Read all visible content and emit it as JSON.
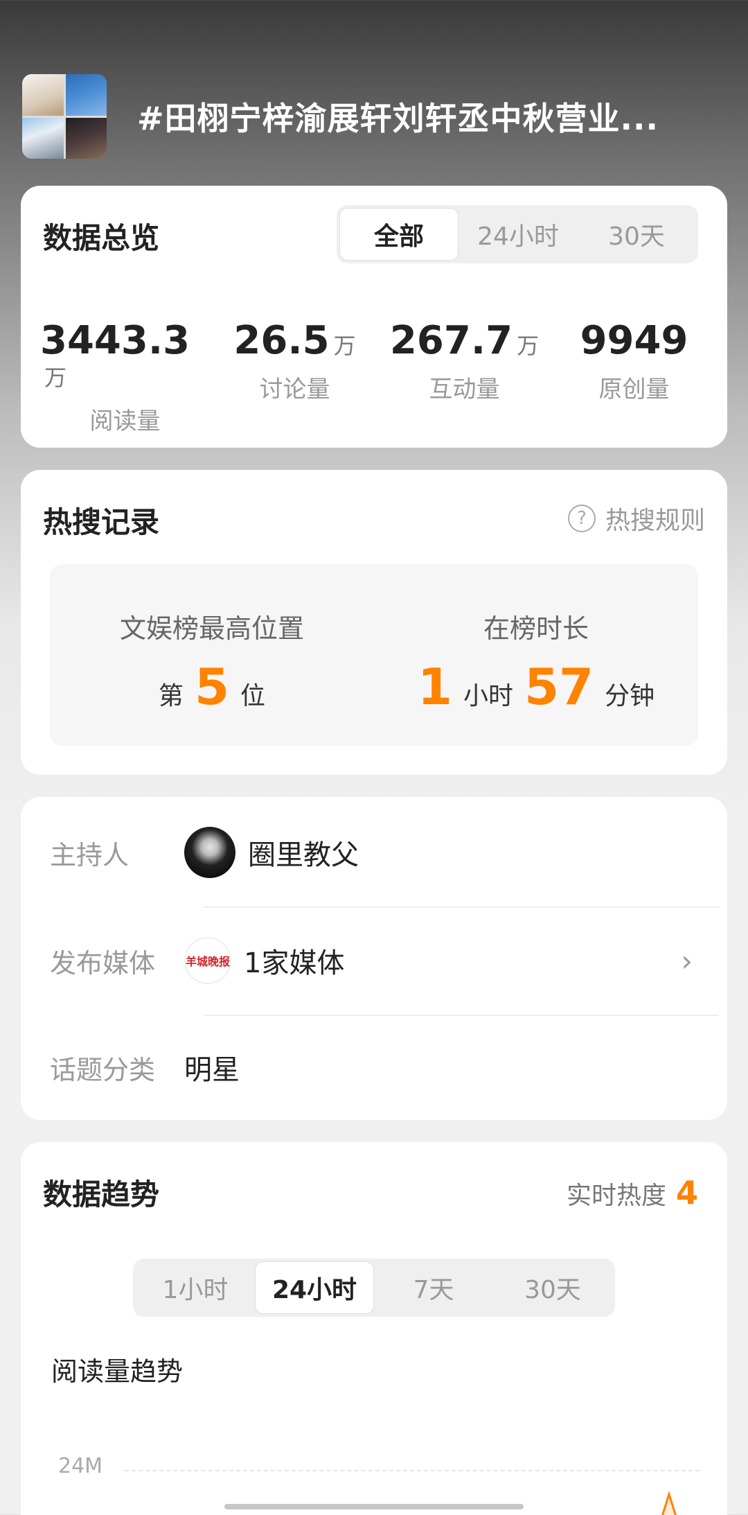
{
  "header": {
    "title": "#田栩宁梓渝展轩刘轩丞中秋营业..."
  },
  "overview": {
    "title": "数据总览",
    "tabs": [
      {
        "label": "全部",
        "active": true
      },
      {
        "label": "24小时",
        "active": false
      },
      {
        "label": "30天",
        "active": false
      }
    ],
    "stats": [
      {
        "value": "3443.3",
        "unit": "万",
        "label": "阅读量"
      },
      {
        "value": "26.5",
        "unit": "万",
        "label": "讨论量"
      },
      {
        "value": "267.7",
        "unit": "万",
        "label": "互动量"
      },
      {
        "value": "9949",
        "unit": "",
        "label": "原创量"
      }
    ]
  },
  "hot_search": {
    "title": "热搜记录",
    "rules_label": "热搜规则",
    "highest_label": "文娱榜最高位置",
    "rank_prefix": "第",
    "rank_value": "5",
    "rank_suffix": "位",
    "duration_label": "在榜时长",
    "hours_value": "1",
    "hours_unit": "小时",
    "minutes_value": "57",
    "minutes_unit": "分钟"
  },
  "info": {
    "host_key": "主持人",
    "host_name": "圈里教父",
    "media_key": "发布媒体",
    "media_logo_text": "羊城晚报",
    "media_value": "1家媒体",
    "category_key": "话题分类",
    "category_value": "明星"
  },
  "trend": {
    "title": "数据趋势",
    "realtime_label": "实时热度",
    "realtime_value": "4",
    "tabs": [
      {
        "label": "1小时",
        "active": false
      },
      {
        "label": "24小时",
        "active": true
      },
      {
        "label": "7天",
        "active": false
      },
      {
        "label": "30天",
        "active": false
      }
    ],
    "chart_title": "阅读量趋势",
    "y_tick": "24M"
  },
  "colors": {
    "accent": "#ff8200",
    "media_logo": "#d4232b"
  }
}
